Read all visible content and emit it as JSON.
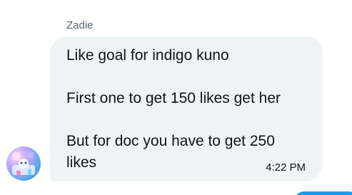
{
  "conversation": {
    "sender_name": "Zadie",
    "message": {
      "lines": [
        "Like goal for indigo kuno",
        "First one to get 150 likes get her",
        "But for doc you have to get 250",
        "likes"
      ],
      "timestamp": "4:22 PM"
    },
    "avatar_icon": "user-avatar-icon",
    "bubble_color": "#eff3f4",
    "accent_color": "#1d9bf0"
  }
}
